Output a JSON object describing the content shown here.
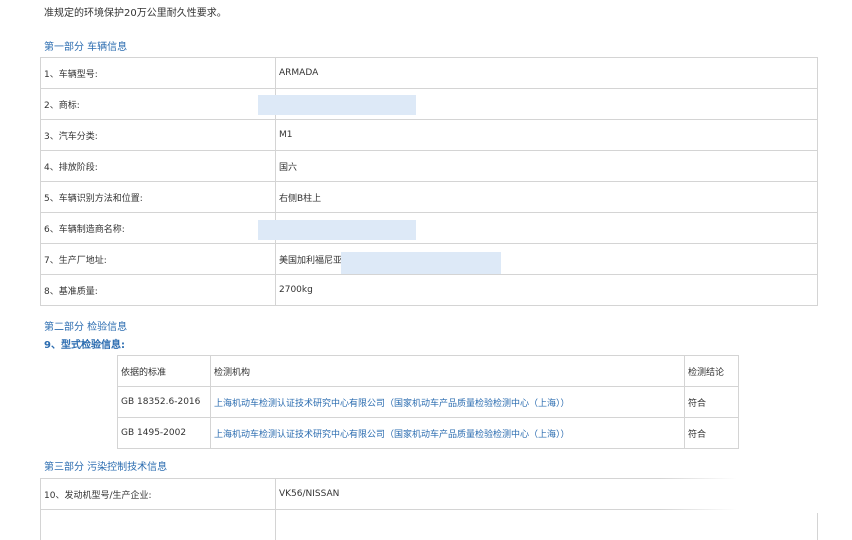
{
  "intro_text": "准规定的环境保护20万公里耐久性要求。",
  "section1": {
    "title": "第一部分 车辆信息",
    "rows": [
      {
        "label": "1、车辆型号:",
        "value": "ARMADA"
      },
      {
        "label": "2、商标:",
        "value": ""
      },
      {
        "label": "3、汽车分类:",
        "value": "M1"
      },
      {
        "label": "4、排放阶段:",
        "value": "国六"
      },
      {
        "label": "5、车辆识别方法和位置:",
        "value": "右侧B柱上"
      },
      {
        "label": "6、车辆制造商名称:",
        "value": ""
      },
      {
        "label": "7、生产厂地址:",
        "value": "美国加利福尼亚"
      },
      {
        "label": "8、基准质量:",
        "value": "2700kg"
      }
    ]
  },
  "section2": {
    "title": "第二部分 检验信息",
    "subtitle": "9、型式检验信息:",
    "headers": [
      "依据的标准",
      "检测机构",
      "检测结论"
    ],
    "rows": [
      {
        "standard": "GB 18352.6-2016",
        "agency": "上海机动车检测认证技术研究中心有限公司（国家机动车产品质量检验检测中心（上海））",
        "result": "符合"
      },
      {
        "standard": "GB 1495-2002",
        "agency": "上海机动车检测认证技术研究中心有限公司（国家机动车产品质量检验检测中心（上海））",
        "result": "符合"
      }
    ]
  },
  "section3": {
    "title": "第三部分 污染控制技术信息",
    "rows": [
      {
        "label": "10、发动机型号/生产企业:",
        "value": "VK56/NISSAN"
      }
    ]
  }
}
